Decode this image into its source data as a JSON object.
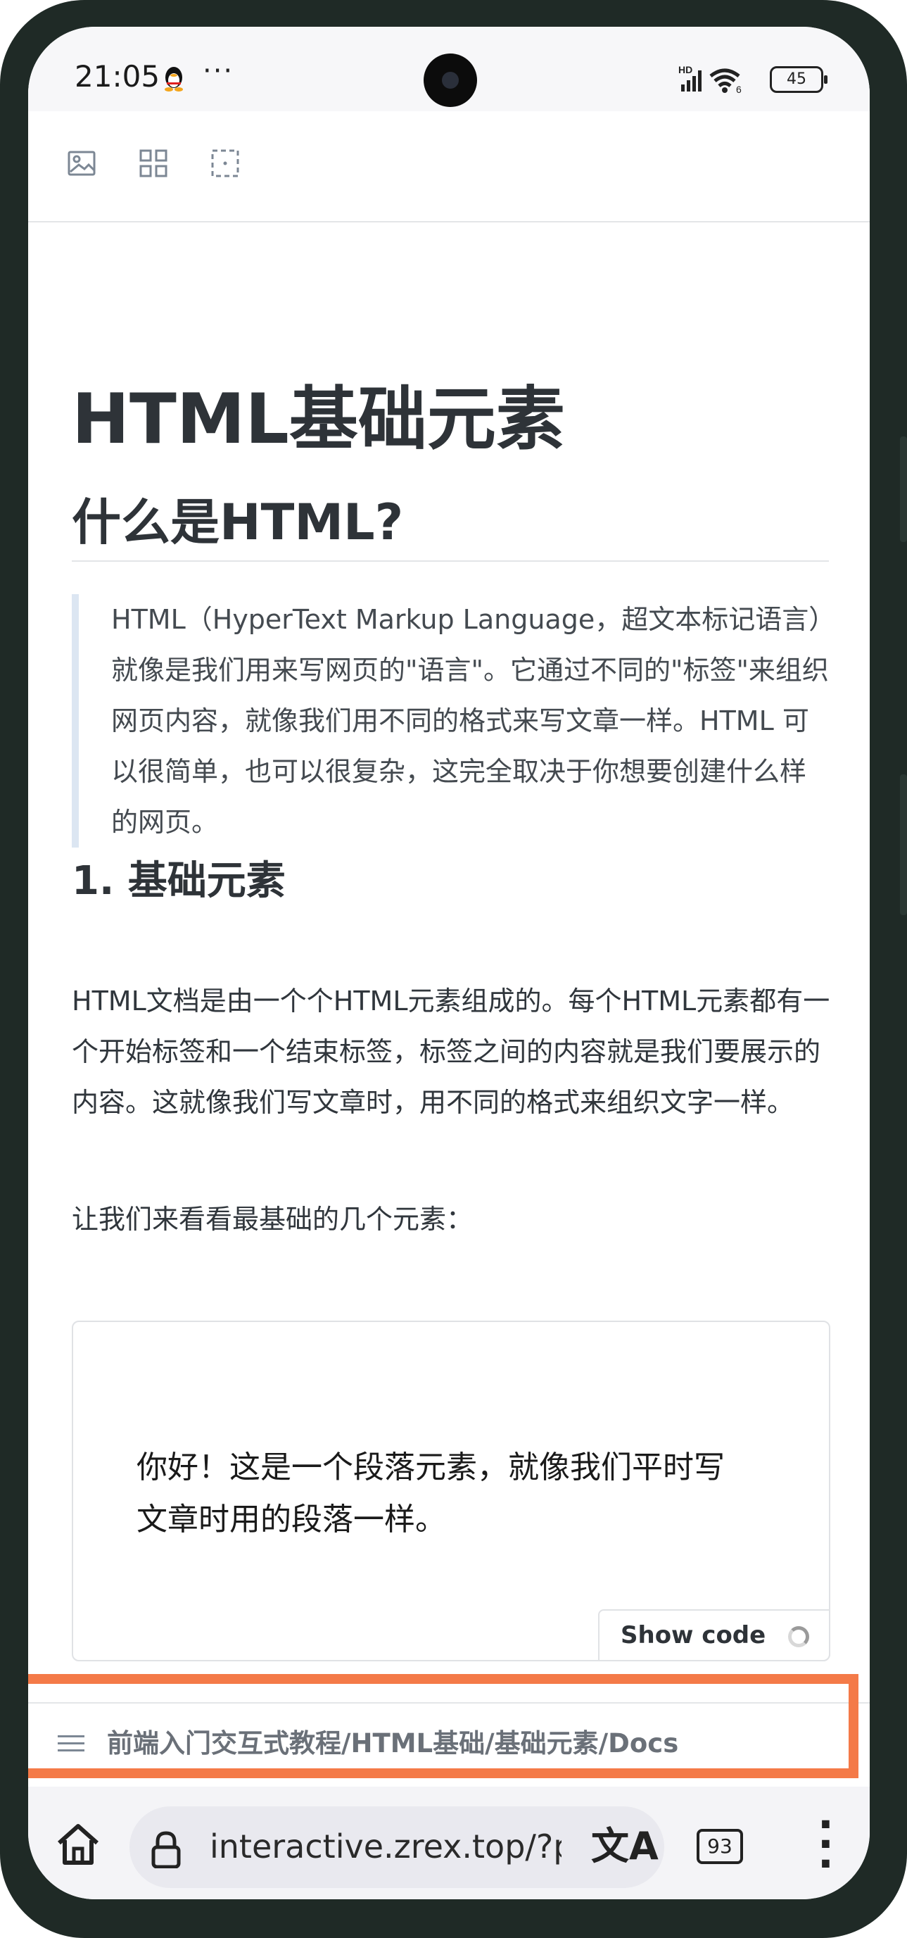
{
  "status_bar": {
    "time": "21:05",
    "dots": "···",
    "network": "HD",
    "wifi_sub": "6",
    "battery": "45"
  },
  "toolbar": {
    "icons": [
      "image-icon",
      "grid-icon",
      "select-icon"
    ]
  },
  "article": {
    "title": "HTML基础元素",
    "subtitle": "什么是HTML?",
    "quote": "HTML（HyperText Markup Language，超文本标记语言）就像是我们用来写网页的\"语言\"。它通过不同的\"标签\"来组织网页内容，就像我们用不同的格式来写文章一样。HTML 可以很简单，也可以很复杂，这完全取决于你想要创建什么样的网页。",
    "section_heading": "1. 基础元素",
    "paragraph": "HTML文档是由一个个HTML元素组成的。每个HTML元素都有一个开始标签和一个结束标签，标签之间的内容就是我们要展示的内容。这就像我们写文章时，用不同的格式来组织文字一样。",
    "intro_line": "让我们来看看最基础的几个元素：",
    "demo_text": "你好！这是一个段落元素，就像我们平时写文章时用的段落一样。",
    "show_code_label": "Show code"
  },
  "breadcrumb": {
    "path": "前端入门交互式教程/HTML基础/基础元素/Docs",
    "highlight_color": "#f47a48"
  },
  "browser": {
    "url": "interactive.zrex.top/?path",
    "translate_icon": "文A",
    "tab_count": "93"
  }
}
